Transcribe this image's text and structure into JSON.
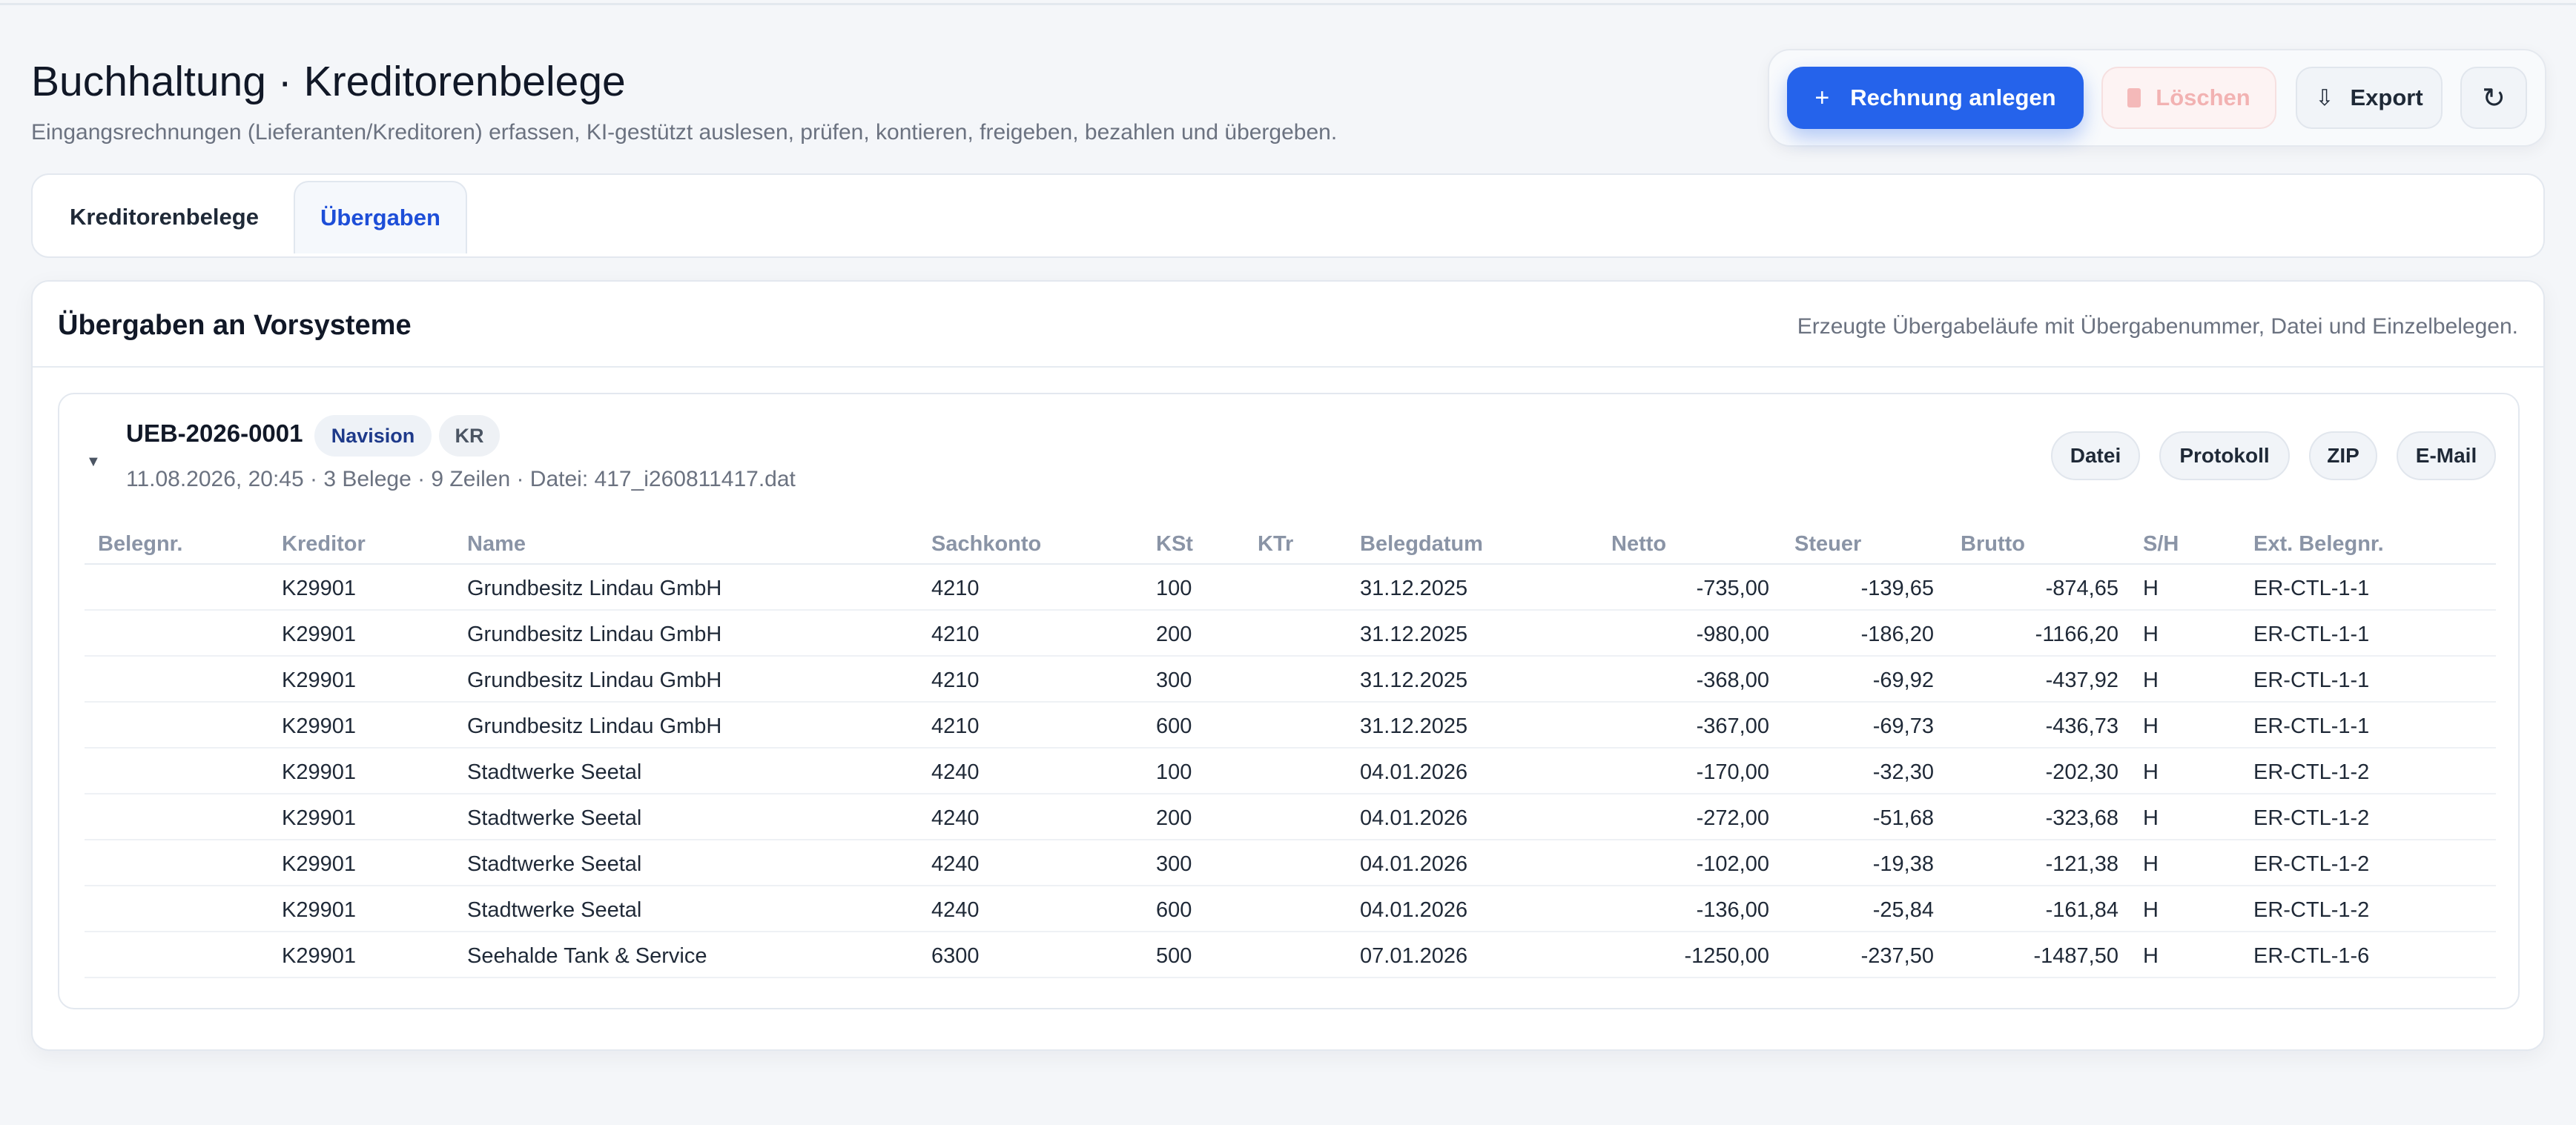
{
  "page": {
    "title": "Buchhaltung · Kreditorenbelege",
    "subtitle": "Eingangsrechnungen (Lieferanten/Kreditoren) erfassen, KI-gestützt auslesen, prüfen, kontieren, freigeben, bezahlen und übergeben."
  },
  "toolbar": {
    "create_label": "Rechnung anlegen",
    "create_icon": "plus-icon",
    "delete_label": "Löschen",
    "delete_icon": "trash-icon",
    "delete_disabled": true,
    "export_label": "Export",
    "export_icon": "download-icon",
    "refresh_icon": "refresh-icon"
  },
  "tabs": [
    {
      "label": "Kreditorenbelege",
      "active": false
    },
    {
      "label": "Übergaben",
      "active": true
    }
  ],
  "section": {
    "title": "Übergaben an Vorsysteme",
    "description": "Erzeugte Übergabeläufe mit Übergabenummer, Datei und Einzelbelegen."
  },
  "transfer": {
    "id": "UEB-2026-0001",
    "system": "Navision",
    "type": "KR",
    "meta": "11.08.2026, 20:45 · 3 Belege · 9 Zeilen · Datei: 417_i260811417.dat",
    "expanded": true,
    "actions": {
      "file": "Datei",
      "log": "Protokoll",
      "zip": "ZIP",
      "email": "E-Mail"
    }
  },
  "columns": [
    "Belegnr.",
    "Kreditor",
    "Name",
    "Sachkonto",
    "KSt",
    "KTr",
    "Belegdatum",
    "Netto",
    "Steuer",
    "Brutto",
    "S/H",
    "Ext. Belegnr."
  ],
  "rows": [
    {
      "belegnr": "",
      "kreditor": "K29901",
      "name": "Grundbesitz Lindau GmbH",
      "sachkonto": "4210",
      "kst": "100",
      "ktr": "",
      "datum": "31.12.2025",
      "netto": "-735,00",
      "steuer": "-139,65",
      "brutto": "-874,65",
      "sh": "H",
      "ext": "ER-CTL-1-1"
    },
    {
      "belegnr": "",
      "kreditor": "K29901",
      "name": "Grundbesitz Lindau GmbH",
      "sachkonto": "4210",
      "kst": "200",
      "ktr": "",
      "datum": "31.12.2025",
      "netto": "-980,00",
      "steuer": "-186,20",
      "brutto": "-1166,20",
      "sh": "H",
      "ext": "ER-CTL-1-1"
    },
    {
      "belegnr": "",
      "kreditor": "K29901",
      "name": "Grundbesitz Lindau GmbH",
      "sachkonto": "4210",
      "kst": "300",
      "ktr": "",
      "datum": "31.12.2025",
      "netto": "-368,00",
      "steuer": "-69,92",
      "brutto": "-437,92",
      "sh": "H",
      "ext": "ER-CTL-1-1"
    },
    {
      "belegnr": "",
      "kreditor": "K29901",
      "name": "Grundbesitz Lindau GmbH",
      "sachkonto": "4210",
      "kst": "600",
      "ktr": "",
      "datum": "31.12.2025",
      "netto": "-367,00",
      "steuer": "-69,73",
      "brutto": "-436,73",
      "sh": "H",
      "ext": "ER-CTL-1-1"
    },
    {
      "belegnr": "",
      "kreditor": "K29901",
      "name": "Stadtwerke Seetal",
      "sachkonto": "4240",
      "kst": "100",
      "ktr": "",
      "datum": "04.01.2026",
      "netto": "-170,00",
      "steuer": "-32,30",
      "brutto": "-202,30",
      "sh": "H",
      "ext": "ER-CTL-1-2"
    },
    {
      "belegnr": "",
      "kreditor": "K29901",
      "name": "Stadtwerke Seetal",
      "sachkonto": "4240",
      "kst": "200",
      "ktr": "",
      "datum": "04.01.2026",
      "netto": "-272,00",
      "steuer": "-51,68",
      "brutto": "-323,68",
      "sh": "H",
      "ext": "ER-CTL-1-2"
    },
    {
      "belegnr": "",
      "kreditor": "K29901",
      "name": "Stadtwerke Seetal",
      "sachkonto": "4240",
      "kst": "300",
      "ktr": "",
      "datum": "04.01.2026",
      "netto": "-102,00",
      "steuer": "-19,38",
      "brutto": "-121,38",
      "sh": "H",
      "ext": "ER-CTL-1-2"
    },
    {
      "belegnr": "",
      "kreditor": "K29901",
      "name": "Stadtwerke Seetal",
      "sachkonto": "4240",
      "kst": "600",
      "ktr": "",
      "datum": "04.01.2026",
      "netto": "-136,00",
      "steuer": "-25,84",
      "brutto": "-161,84",
      "sh": "H",
      "ext": "ER-CTL-1-2"
    },
    {
      "belegnr": "",
      "kreditor": "K29901",
      "name": "Seehalde Tank & Service",
      "sachkonto": "6300",
      "kst": "500",
      "ktr": "",
      "datum": "07.01.2026",
      "netto": "-1250,00",
      "steuer": "-237,50",
      "brutto": "-1487,50",
      "sh": "H",
      "ext": "ER-CTL-1-6"
    }
  ],
  "colors": {
    "primary": "#2563eb",
    "background": "#f4f6f9",
    "danger_disabled": "#f2b2b2",
    "muted_text": "#6b7280",
    "header_text": "#8a94a6"
  }
}
